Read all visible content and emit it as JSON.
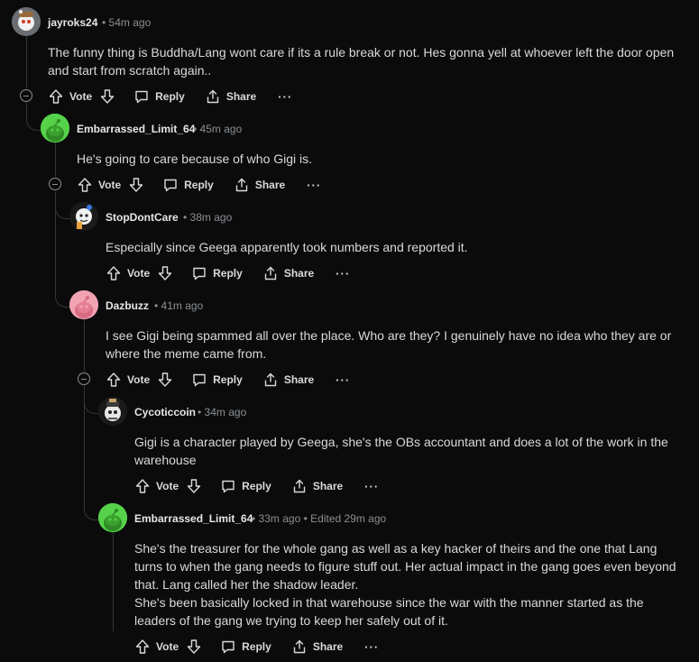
{
  "comments": [
    {
      "user": "jayroks24",
      "time": "54m ago",
      "edited": "",
      "body": [
        "The funny thing is Buddha/Lang wont care if its a rule break or not. Hes gonna yell at whoever left the door open and start from scratch again.."
      ]
    },
    {
      "user": "Embarrassed_Limit_64",
      "time": "45m ago",
      "edited": "",
      "body": [
        "He's going to care because of who Gigi is."
      ]
    },
    {
      "user": "StopDontCare",
      "time": "38m ago",
      "edited": "",
      "body": [
        "Especially since Geega apparently took numbers and reported it."
      ]
    },
    {
      "user": "Dazbuzz",
      "time": "41m ago",
      "edited": "",
      "body": [
        "I see Gigi being spammed all over the place. Who are they? I genuinely have no idea who they are or where the meme came from."
      ]
    },
    {
      "user": "Cycoticcoin",
      "time": "34m ago",
      "edited": "",
      "body": [
        "Gigi is a character played by Geega, she's the OBs accountant and does a lot of the work in the warehouse"
      ]
    },
    {
      "user": "Embarrassed_Limit_64",
      "time": "33m ago",
      "edited": "Edited 29m ago",
      "body": [
        "She's the treasurer for the whole gang as well as a key hacker of theirs and the one that Lang turns to when the gang needs to figure stuff out. Her actual impact in the gang goes even beyond that. Lang called her the shadow leader.",
        "She's been basically locked in that warehouse since the war with the manner started as the leaders of the gang we trying to keep her safely out of it."
      ]
    }
  ],
  "actions": {
    "vote": "Vote",
    "reply": "Reply",
    "share": "Share",
    "more": "···"
  },
  "separator": "•"
}
